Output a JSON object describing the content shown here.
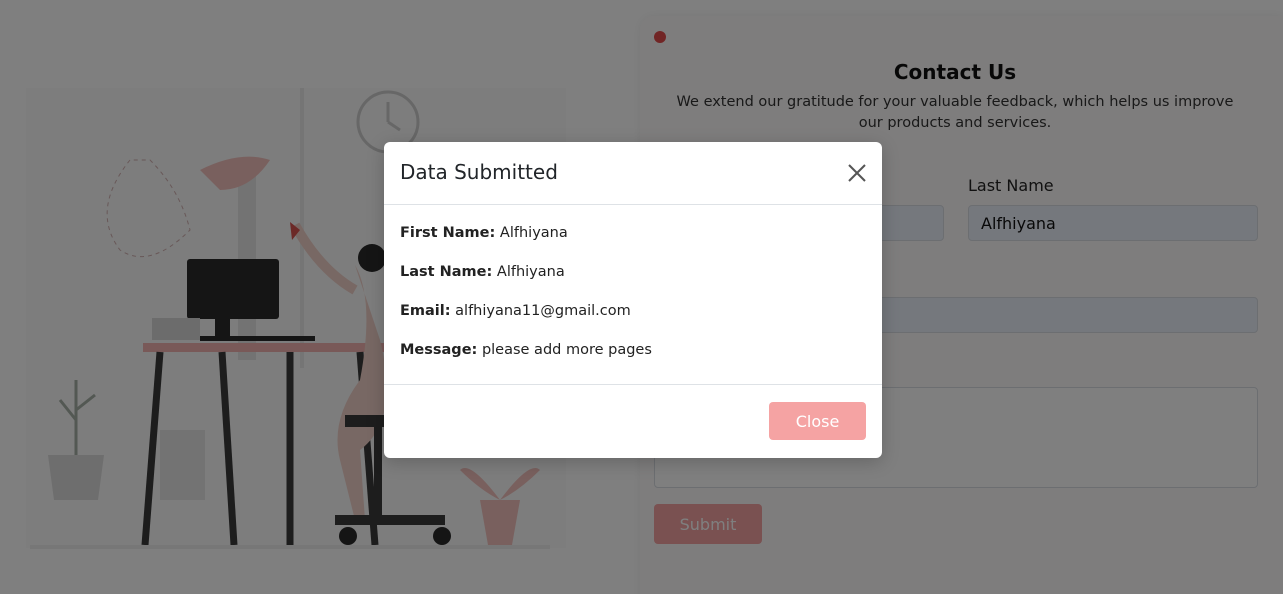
{
  "form": {
    "title": "Contact Us",
    "subtitle": "We extend our gratitude for your valuable feedback, which helps us improve our products and services.",
    "last_name_label": "Last Name",
    "last_name_value": "Alfhiyana",
    "submit_label": "Submit"
  },
  "modal": {
    "title": "Data Submitted",
    "fields": [
      {
        "label": "First Name:",
        "value": "Alfhiyana"
      },
      {
        "label": "Last Name:",
        "value": "Alfhiyana"
      },
      {
        "label": "Email:",
        "value": "alfhiyana11@gmail.com"
      },
      {
        "label": "Message:",
        "value": "please add more pages"
      }
    ],
    "close_label": "Close"
  },
  "icons": {
    "close": "close-icon",
    "window": "red-dot-icon"
  },
  "colors": {
    "accent": "#f5a3a3",
    "dot": "#e24a4a"
  }
}
